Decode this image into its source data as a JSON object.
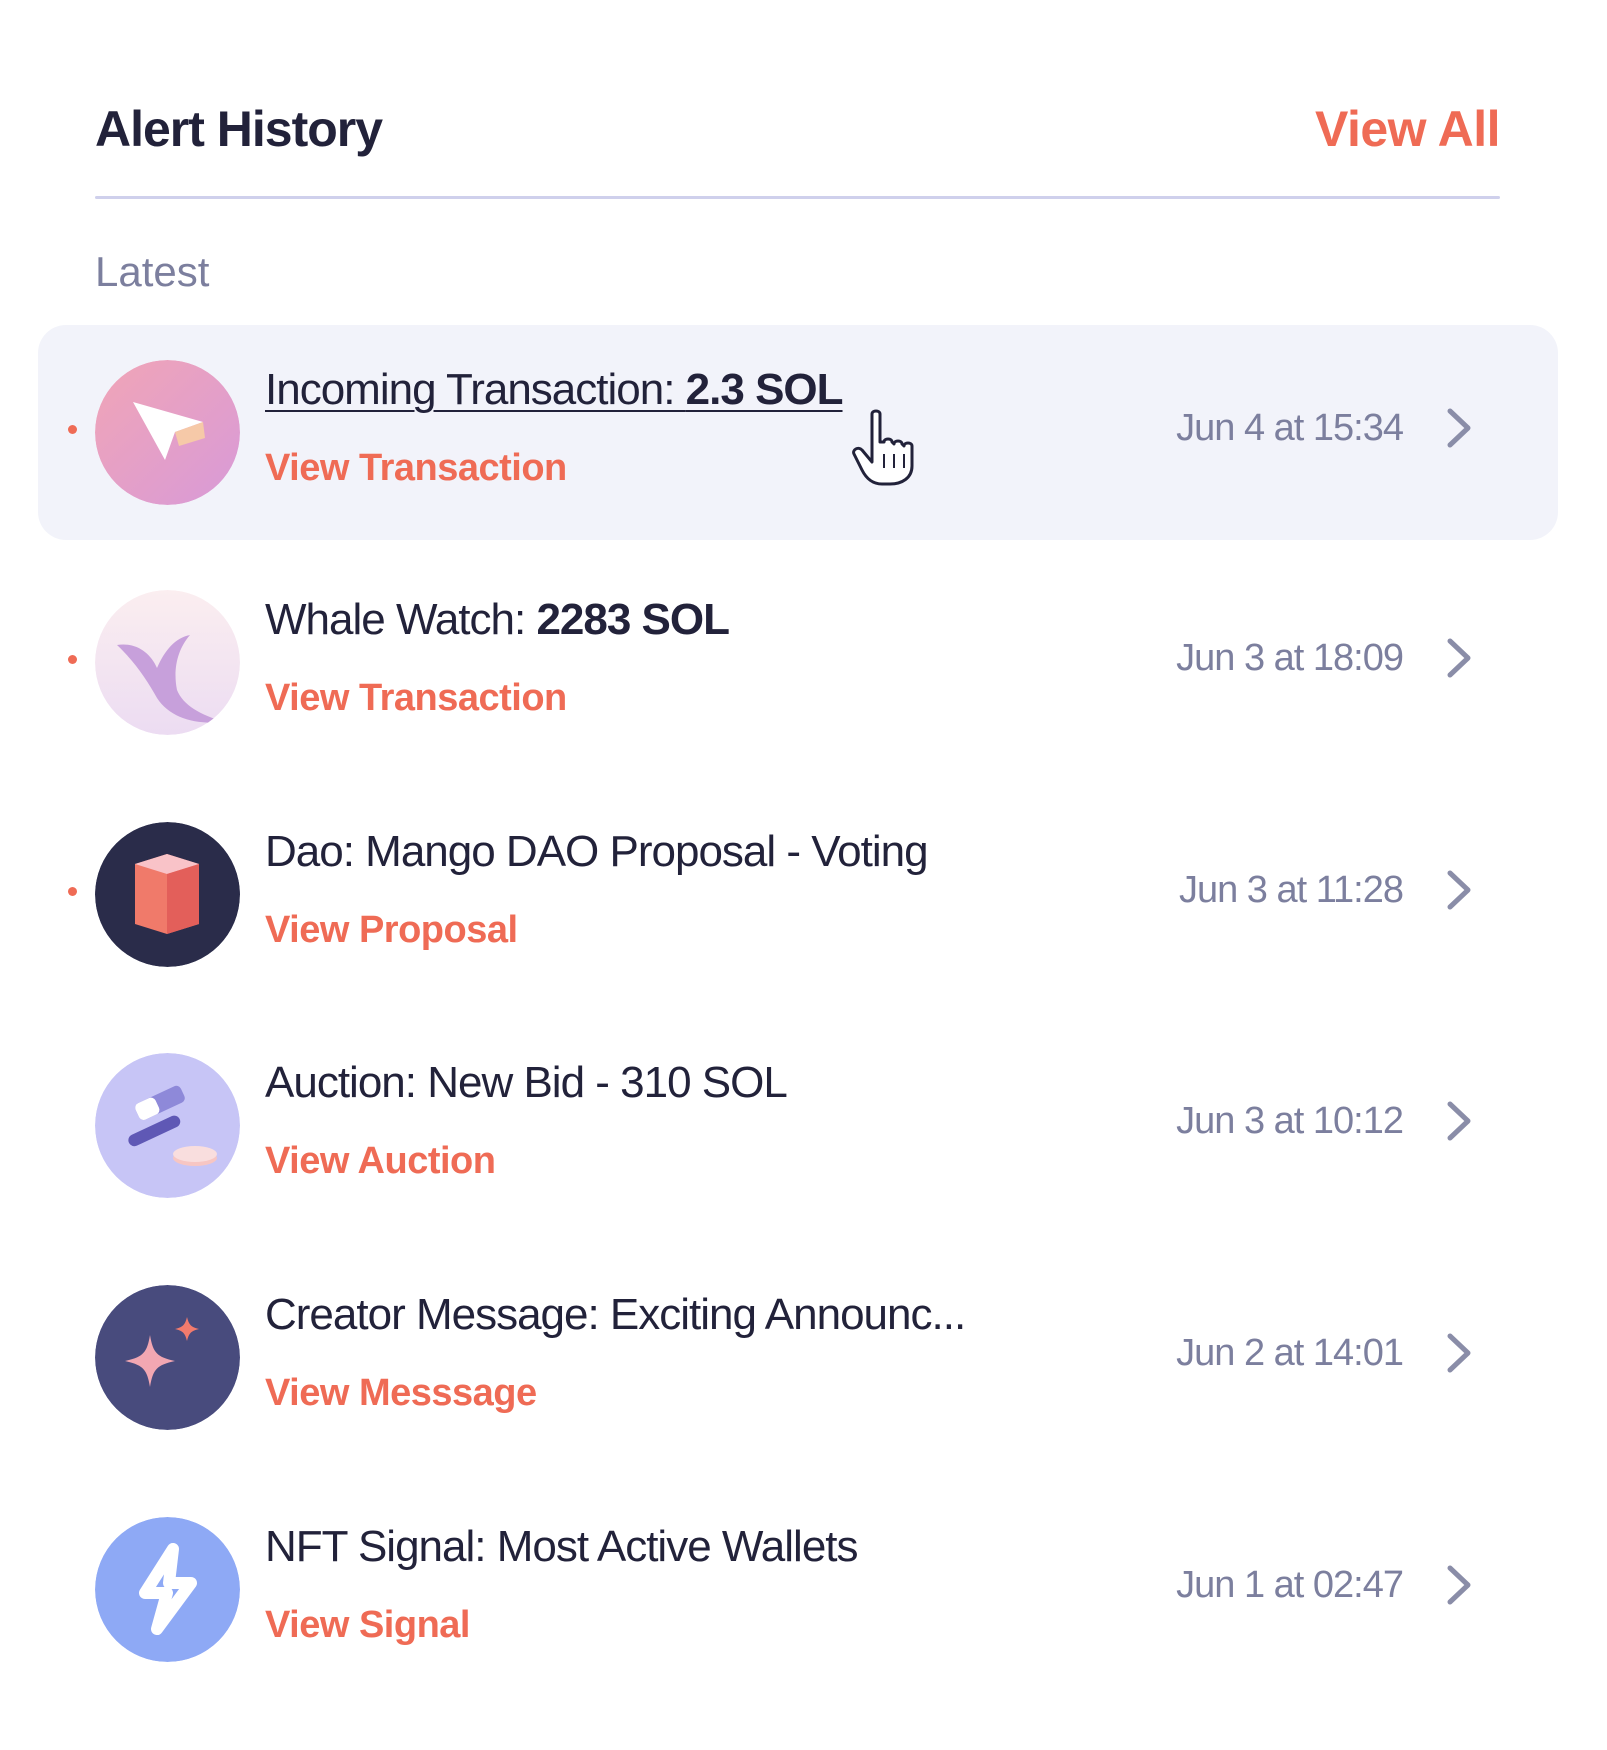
{
  "header": {
    "title": "Alert History",
    "view_all": "View All"
  },
  "section": {
    "label": "Latest"
  },
  "colors": {
    "accent": "#ef6b55",
    "text": "#22223a",
    "muted": "#7c7f9e",
    "active_row": "#f2f3fa"
  },
  "alerts": [
    {
      "title_prefix": "Incoming Transaction: ",
      "title_bold": "2.3 SOL",
      "link": "View Transaction",
      "date": "Jun 4 at 15:34",
      "icon": "arrow-cursor-icon",
      "unread": true,
      "active": true
    },
    {
      "title_prefix": "Whale Watch: ",
      "title_bold": "2283 SOL",
      "link": "View Transaction",
      "date": "Jun 3 at 18:09",
      "icon": "whale-tail-icon",
      "unread": true,
      "active": false
    },
    {
      "title_prefix": "Dao: Mango DAO Proposal - Voting",
      "title_bold": "",
      "link": "View Proposal",
      "date": "Jun 3 at 11:28",
      "icon": "cube-icon",
      "unread": true,
      "active": false
    },
    {
      "title_prefix": "Auction: New Bid - 310 SOL",
      "title_bold": "",
      "link": "View Auction",
      "date": "Jun 3 at 10:12",
      "icon": "gavel-icon",
      "unread": false,
      "active": false
    },
    {
      "title_prefix": "Creator Message: Exciting Announc...",
      "title_bold": "",
      "link": "View Messsage",
      "date": "Jun 2 at 14:01",
      "icon": "sparkle-icon",
      "unread": false,
      "active": false
    },
    {
      "title_prefix": "NFT Signal: Most Active Wallets",
      "title_bold": "",
      "link": "View Signal",
      "date": "Jun 1 at 02:47",
      "icon": "lightning-bolt-icon",
      "unread": false,
      "active": false
    }
  ]
}
